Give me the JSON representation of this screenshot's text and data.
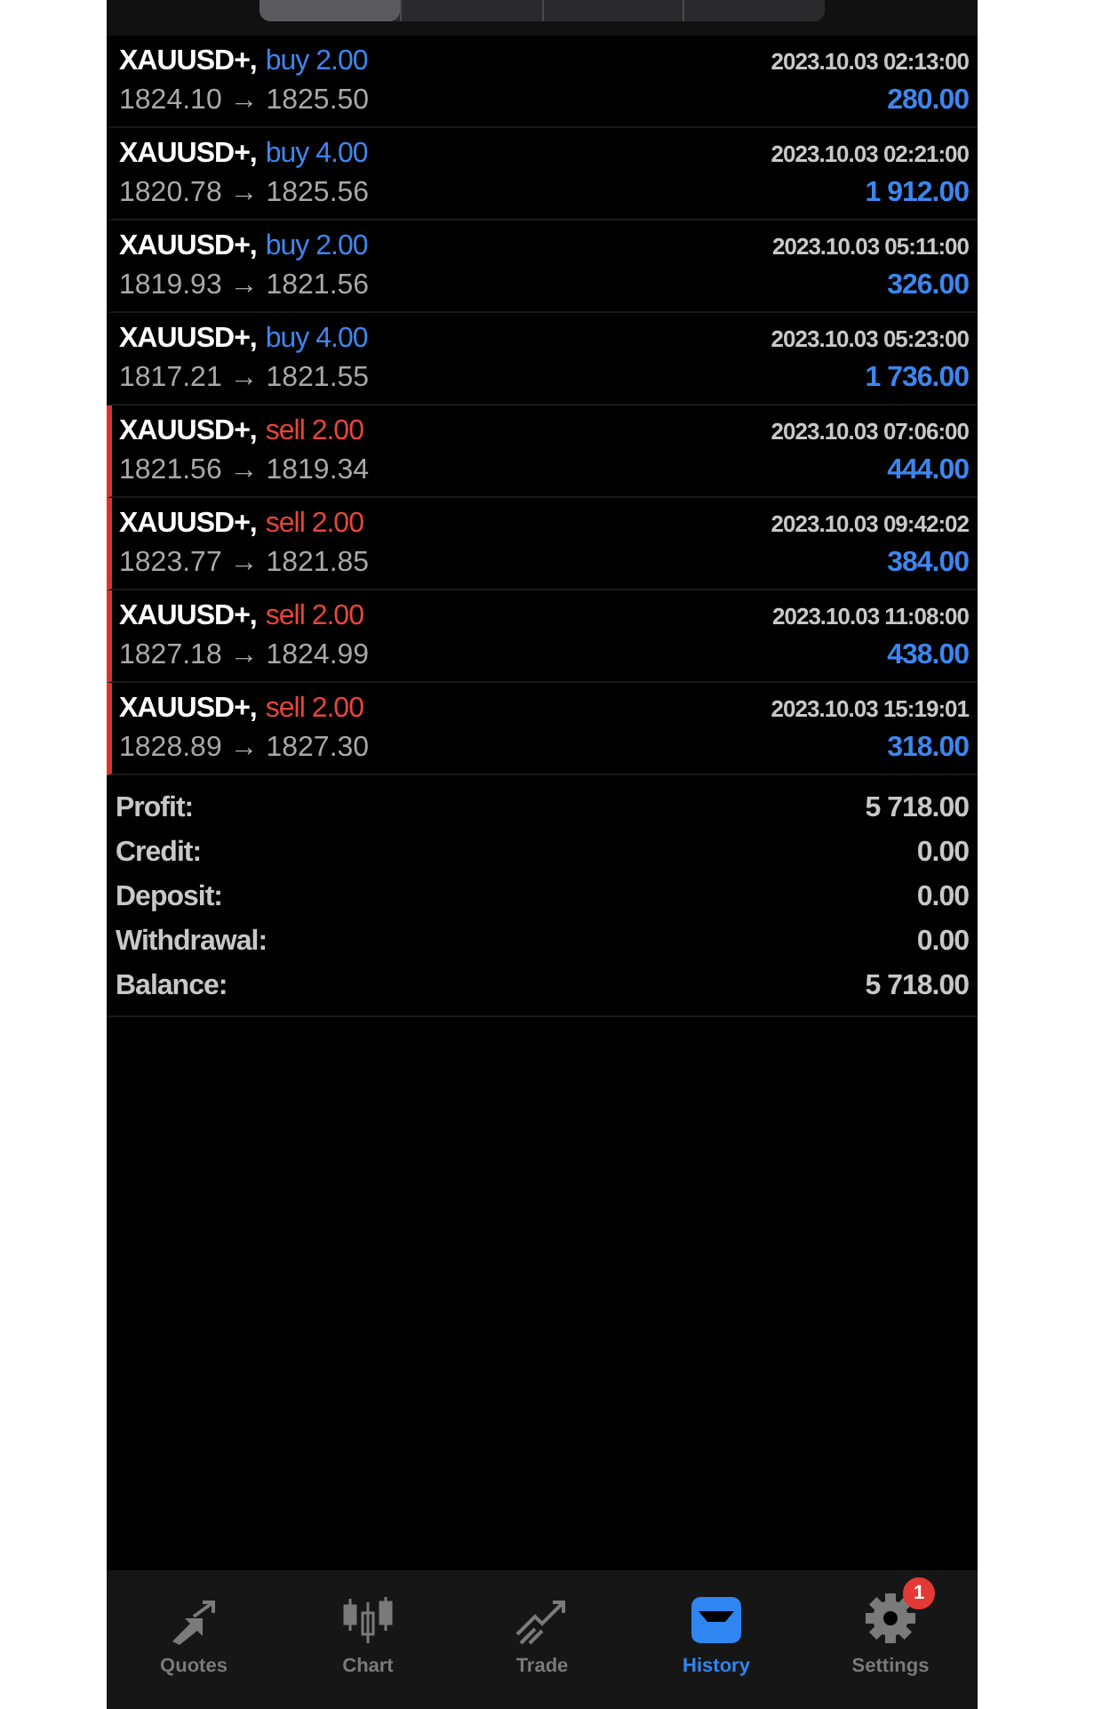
{
  "period_tabs": [
    {
      "selected": true
    },
    {
      "selected": false
    },
    {
      "selected": false
    },
    {
      "selected": false
    }
  ],
  "deals": [
    {
      "symbol": "XAUUSD+,",
      "side": "buy",
      "is_sell": false,
      "volume": "2.00",
      "prices": "1824.10 → 1825.50",
      "time": "2023.10.03 02:13:00",
      "profit": "280.00"
    },
    {
      "symbol": "XAUUSD+,",
      "side": "buy",
      "is_sell": false,
      "volume": "4.00",
      "prices": "1820.78 → 1825.56",
      "time": "2023.10.03 02:21:00",
      "profit": "1 912.00"
    },
    {
      "symbol": "XAUUSD+,",
      "side": "buy",
      "is_sell": false,
      "volume": "2.00",
      "prices": "1819.93 → 1821.56",
      "time": "2023.10.03 05:11:00",
      "profit": "326.00"
    },
    {
      "symbol": "XAUUSD+,",
      "side": "buy",
      "is_sell": false,
      "volume": "4.00",
      "prices": "1817.21 → 1821.55",
      "time": "2023.10.03 05:23:00",
      "profit": "1 736.00"
    },
    {
      "symbol": "XAUUSD+,",
      "side": "sell",
      "is_sell": true,
      "volume": "2.00",
      "prices": "1821.56 → 1819.34",
      "time": "2023.10.03 07:06:00",
      "profit": "444.00"
    },
    {
      "symbol": "XAUUSD+,",
      "side": "sell",
      "is_sell": true,
      "volume": "2.00",
      "prices": "1823.77 → 1821.85",
      "time": "2023.10.03 09:42:02",
      "profit": "384.00"
    },
    {
      "symbol": "XAUUSD+,",
      "side": "sell",
      "is_sell": true,
      "volume": "2.00",
      "prices": "1827.18 → 1824.99",
      "time": "2023.10.03 11:08:00",
      "profit": "438.00"
    },
    {
      "symbol": "XAUUSD+,",
      "side": "sell",
      "is_sell": true,
      "volume": "2.00",
      "prices": "1828.89 → 1827.30",
      "time": "2023.10.03 15:19:01",
      "profit": "318.00"
    }
  ],
  "summary": [
    {
      "label": "Profit:",
      "value": "5 718.00"
    },
    {
      "label": "Credit:",
      "value": "0.00"
    },
    {
      "label": "Deposit:",
      "value": "0.00"
    },
    {
      "label": "Withdrawal:",
      "value": "0.00"
    },
    {
      "label": "Balance:",
      "value": "5 718.00"
    }
  ],
  "tab_bar": [
    {
      "kind": "quotes",
      "label": "Quotes",
      "selected": false
    },
    {
      "kind": "chart",
      "label": "Chart",
      "selected": false
    },
    {
      "kind": "trade",
      "label": "Trade",
      "selected": false
    },
    {
      "kind": "history",
      "label": "History",
      "selected": true
    },
    {
      "kind": "settings",
      "label": "Settings",
      "selected": false,
      "badge": "1"
    }
  ]
}
